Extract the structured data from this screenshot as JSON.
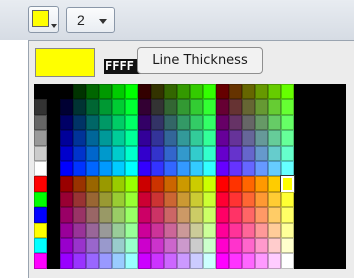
{
  "toolbar": {
    "current_color": "#FFFF00",
    "line_thickness_value": "2",
    "color_button_icon": "color-swatch-dropdown",
    "thickness_dropdown_icon": "chevron-down-icon"
  },
  "color_popup": {
    "preview_color": "#FFFF00",
    "hex_value": "FFFF",
    "tooltip": "Line Thickness",
    "no_color_icon": "no-color-icon",
    "selected_color": "#FFFF00"
  }
}
